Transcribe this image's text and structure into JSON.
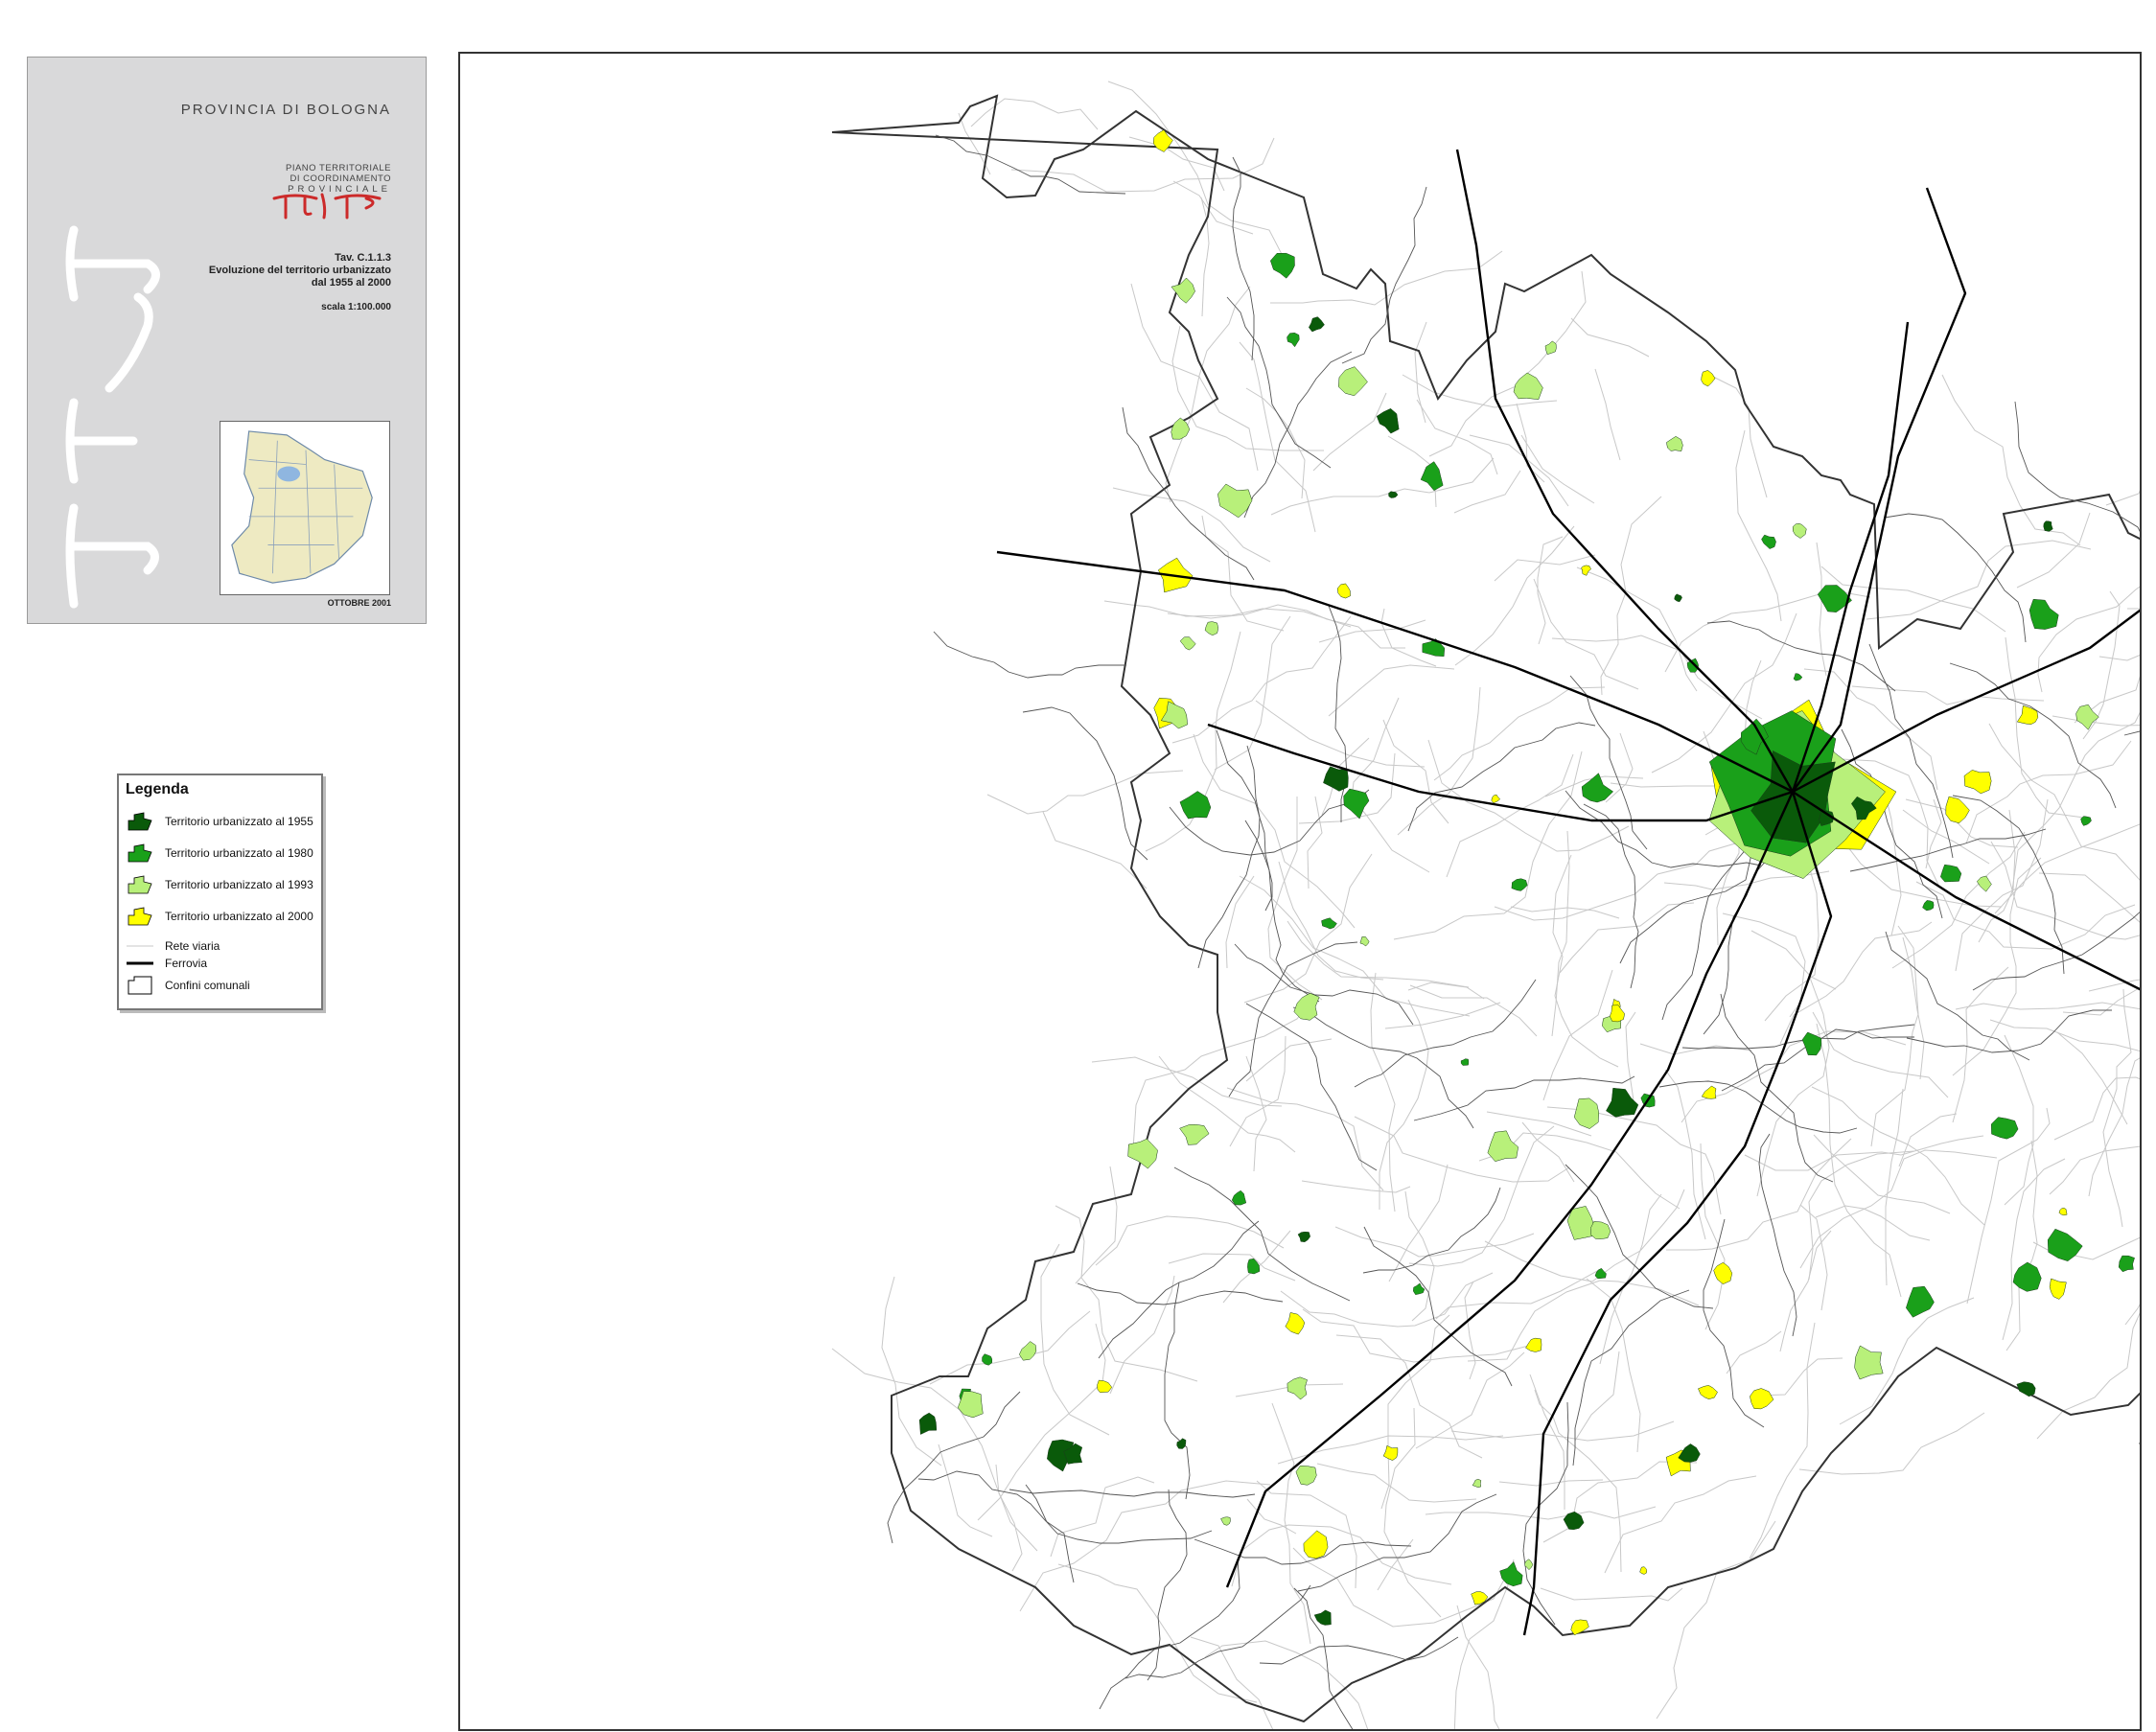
{
  "cover": {
    "organization": "PROVINCIA DI BOLOGNA",
    "plan_line1": "PIANO TERRITORIALE",
    "plan_line2": "DI COORDINAMENTO",
    "plan_line3": "PROVINCIALE",
    "plan_logo": "PTCP",
    "table_number": "Tav. C.1.1.3",
    "table_title_line1": "Evoluzione del territorio urbanizzato",
    "table_title_line2": "dal 1955 al 2000",
    "scale": "scala 1:100.000",
    "date": "OTTOBRE 2001",
    "logo_color": "#cc2a2a"
  },
  "legend": {
    "title": "Legenda",
    "items": [
      {
        "label": "Territorio urbanizzato al 1955",
        "color": "#0a5a0a",
        "kind": "fill"
      },
      {
        "label": "Territorio urbanizzato al 1980",
        "color": "#1aa01a",
        "kind": "fill"
      },
      {
        "label": "Territorio urbanizzato al 1993",
        "color": "#b8f07a",
        "kind": "fill"
      },
      {
        "label": "Territorio urbanizzato al 2000",
        "color": "#ffff00",
        "kind": "fill"
      },
      {
        "label": "Rete viaria",
        "color": "#c8c8c8",
        "kind": "thin-line"
      },
      {
        "label": "Ferrovia",
        "color": "#000000",
        "kind": "thick-line"
      },
      {
        "label": "Confini comunali",
        "color": "#000000",
        "kind": "outline"
      }
    ]
  },
  "colors": {
    "urb_1955": "#0a5a0a",
    "urb_1980": "#1aa01a",
    "urb_1993": "#b8f07a",
    "urb_2000": "#ffff00",
    "road": "#c8c8c8",
    "railway": "#000000",
    "boundary": "#333333"
  }
}
